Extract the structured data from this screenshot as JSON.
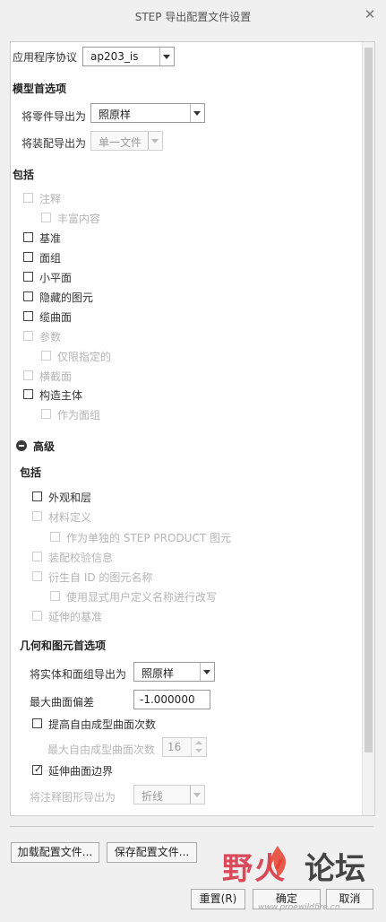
{
  "window": {
    "title": "STEP 导出配置文件设置",
    "close_icon": "close-icon"
  },
  "app_protocol": {
    "label": "应用程序协议",
    "value": "ap203_is"
  },
  "model_options": {
    "header": "模型首选项",
    "part_export_label": "将零件导出为",
    "part_export_value": "照原样",
    "asm_export_label": "将装配导出为",
    "asm_export_value": "单一文件"
  },
  "include": {
    "header": "包括",
    "items": [
      {
        "label": "注释",
        "checked": false,
        "enabled": false
      },
      {
        "label": "丰富内容",
        "checked": false,
        "enabled": false
      },
      {
        "label": "基准",
        "checked": false,
        "enabled": true
      },
      {
        "label": "面组",
        "checked": false,
        "enabled": true
      },
      {
        "label": "小平面",
        "checked": false,
        "enabled": true
      },
      {
        "label": "隐藏的图元",
        "checked": false,
        "enabled": true
      },
      {
        "label": "缆曲面",
        "checked": false,
        "enabled": true
      },
      {
        "label": "参数",
        "checked": false,
        "enabled": false
      },
      {
        "label": "仅限指定的",
        "checked": false,
        "enabled": false
      },
      {
        "label": "横截面",
        "checked": false,
        "enabled": false
      },
      {
        "label": "构造主体",
        "checked": false,
        "enabled": true
      },
      {
        "label": "作为面组",
        "checked": false,
        "enabled": false
      }
    ]
  },
  "advanced": {
    "header": "高级",
    "include_header": "包括",
    "items": [
      {
        "label": "外观和层",
        "checked": false,
        "enabled": true
      },
      {
        "label": "材料定义",
        "checked": false,
        "enabled": false
      },
      {
        "label": "作为单独的 STEP PRODUCT 图元",
        "checked": false,
        "enabled": false
      },
      {
        "label": "装配校验信息",
        "checked": false,
        "enabled": false
      },
      {
        "label": "衍生自 ID 的图元名称",
        "checked": false,
        "enabled": false
      },
      {
        "label": "使用显式用户定义名称进行改写",
        "checked": false,
        "enabled": false
      },
      {
        "label": "延伸的基准",
        "checked": false,
        "enabled": false
      }
    ],
    "geometry_header": "几何和图元首选项",
    "solid_export_label": "将实体和面组导出为",
    "solid_export_value": "照原样",
    "max_deviation_label": "最大曲面偏差",
    "max_deviation_value": "-1.000000",
    "raise_degree_label": "提高自由成型曲面次数",
    "raise_degree_checked": false,
    "max_degree_label": "最大自由成型曲面次数",
    "max_degree_value": "16",
    "extend_boundary_label": "延伸曲面边界",
    "extend_boundary_checked": true,
    "annotation_export_label": "将注释图形导出为",
    "annotation_export_value": "折线"
  },
  "buttons": {
    "load": "加载配置文件...",
    "save": "保存配置文件...",
    "reset": "重置(R)",
    "ok": "确定",
    "cancel": "取消"
  },
  "watermark": {
    "text_left": "野火",
    "text_right": "论坛",
    "url": "www.proewildfire.cn"
  },
  "tick_glyph": "✓"
}
